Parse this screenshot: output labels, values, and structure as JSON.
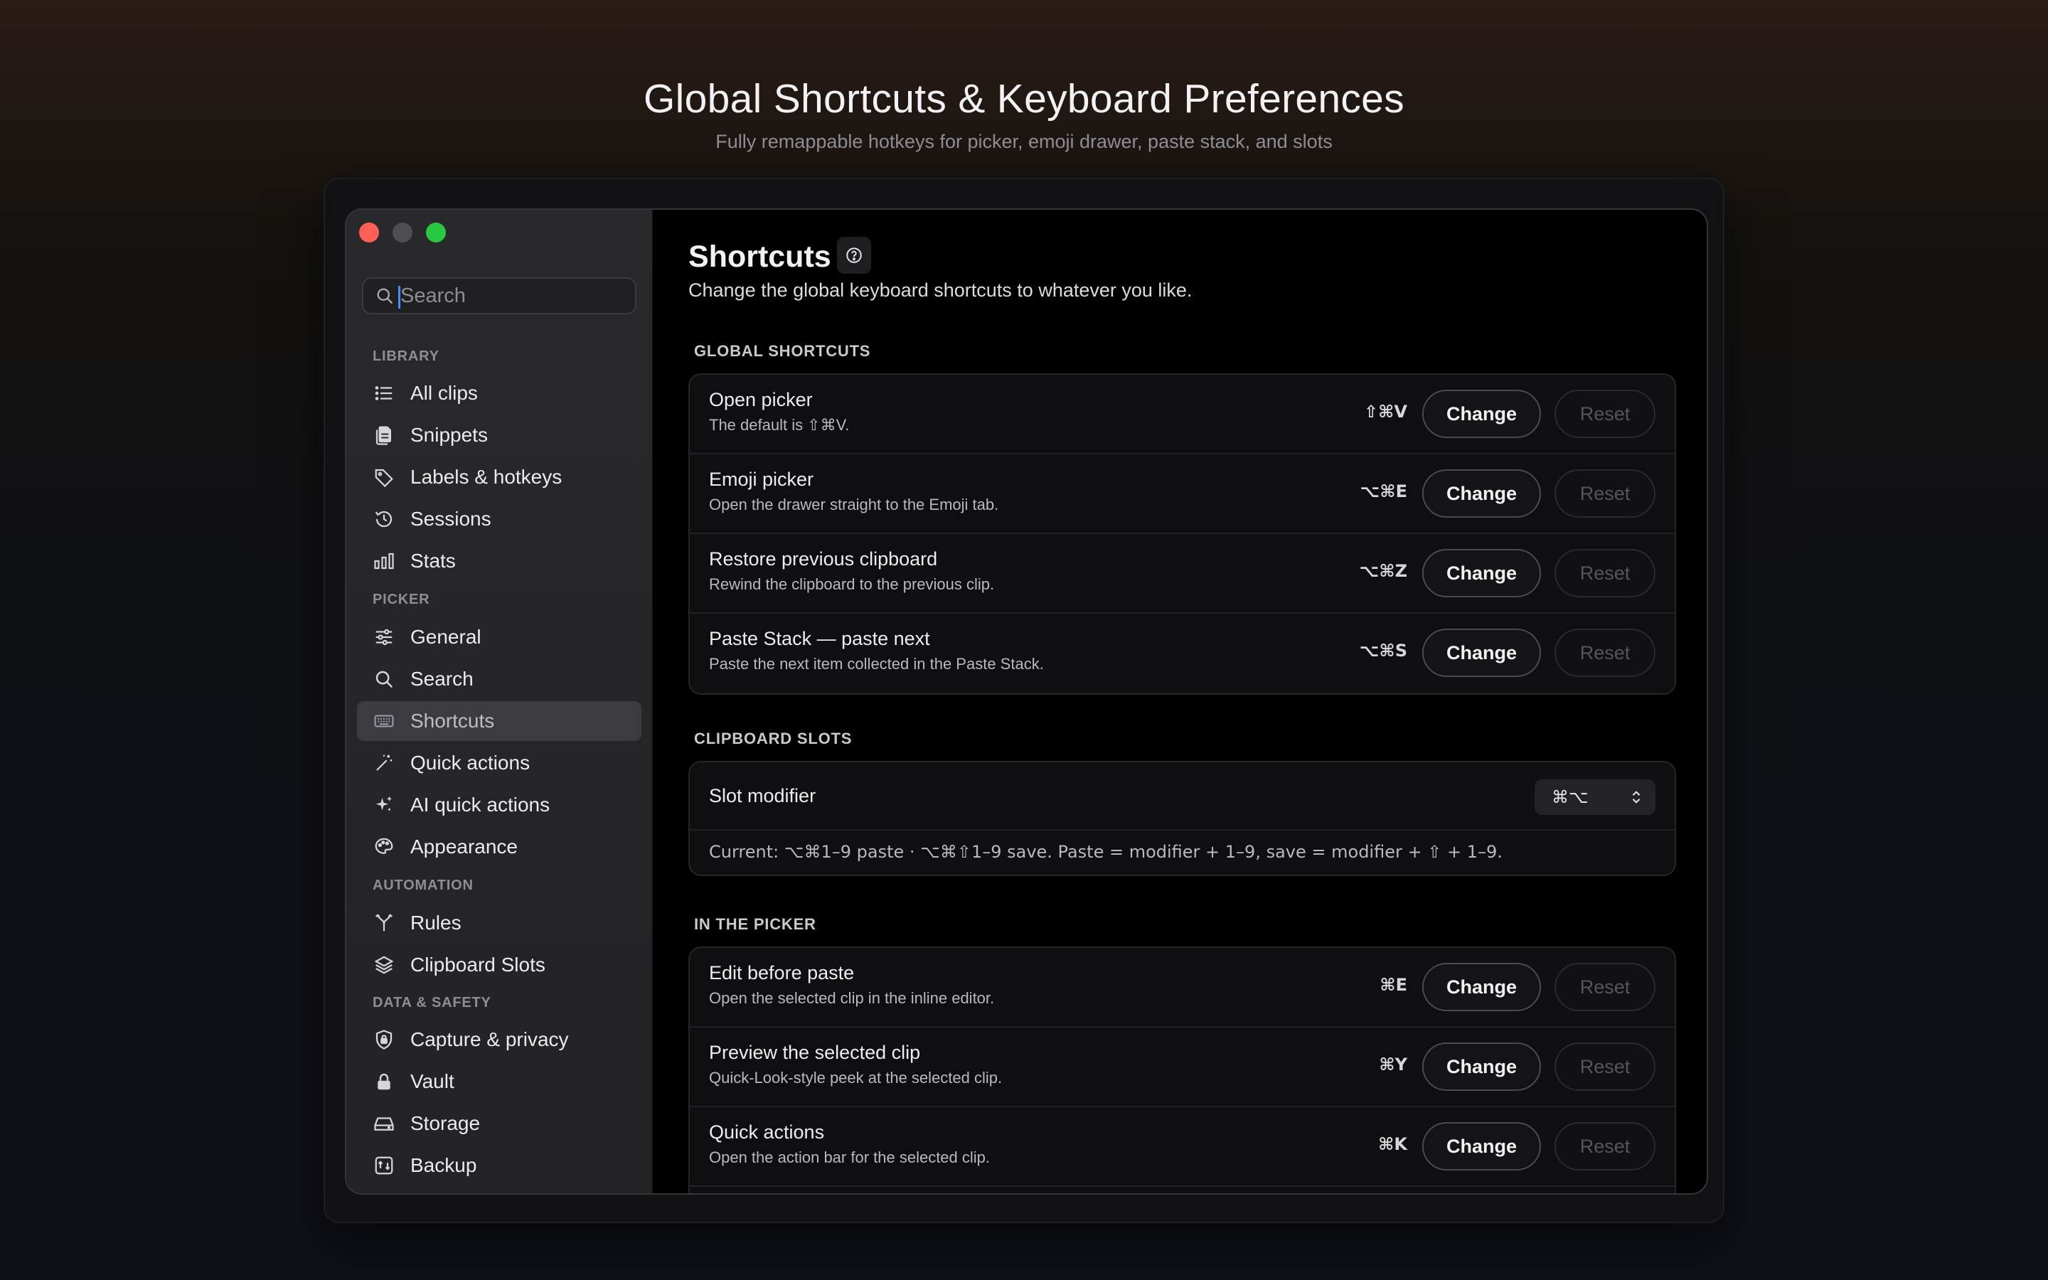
{
  "hero": {
    "title": "Global Shortcuts & Keyboard Preferences",
    "subtitle": "Fully remappable hotkeys for picker, emoji drawer, paste stack, and slots"
  },
  "sidebar": {
    "search_placeholder": "Search",
    "sections": {
      "library": "LIBRARY",
      "picker": "PICKER",
      "automation": "AUTOMATION",
      "data_safety": "DATA & SAFETY"
    },
    "items": {
      "all_clips": "All clips",
      "snippets": "Snippets",
      "labels_hotkeys": "Labels & hotkeys",
      "sessions": "Sessions",
      "stats": "Stats",
      "general": "General",
      "search": "Search",
      "shortcuts": "Shortcuts",
      "quick_actions": "Quick actions",
      "ai_quick_actions": "AI quick actions",
      "appearance": "Appearance",
      "rules": "Rules",
      "clipboard_slots": "Clipboard Slots",
      "capture_privacy": "Capture & privacy",
      "vault": "Vault",
      "storage": "Storage",
      "backup": "Backup"
    },
    "active": "shortcuts"
  },
  "main": {
    "title": "Shortcuts",
    "description": "Change the global keyboard shortcuts to whatever you like.",
    "change_label": "Change",
    "reset_label": "Reset",
    "global": {
      "label": "GLOBAL SHORTCUTS",
      "rows": [
        {
          "title": "Open picker",
          "subtitle": "The default is ⇧⌘V.",
          "keys": "⇧⌘V"
        },
        {
          "title": "Emoji picker",
          "subtitle": "Open the drawer straight to the Emoji tab.",
          "keys": "⌥⌘E"
        },
        {
          "title": "Restore previous clipboard",
          "subtitle": "Rewind the clipboard to the previous clip.",
          "keys": "⌥⌘Z"
        },
        {
          "title": "Paste Stack — paste next",
          "subtitle": "Paste the next item collected in the Paste Stack.",
          "keys": "⌥⌘S"
        }
      ]
    },
    "slots": {
      "label": "CLIPBOARD SLOTS",
      "modifier_title": "Slot modifier",
      "modifier_value": "⌘⌥",
      "current": "Current: ⌥⌘1–9 paste · ⌥⌘⇧1–9 save. Paste = modifier + 1–9, save = modifier + ⇧ + 1–9."
    },
    "picker": {
      "label": "IN THE PICKER",
      "rows": [
        {
          "title": "Edit before paste",
          "subtitle": "Open the selected clip in the inline editor.",
          "keys": "⌘E"
        },
        {
          "title": "Preview the selected clip",
          "subtitle": "Quick-Look-style peek at the selected clip.",
          "keys": "⌘Y"
        },
        {
          "title": "Quick actions",
          "subtitle": "Open the action bar for the selected clip.",
          "keys": "⌘K"
        }
      ]
    }
  }
}
